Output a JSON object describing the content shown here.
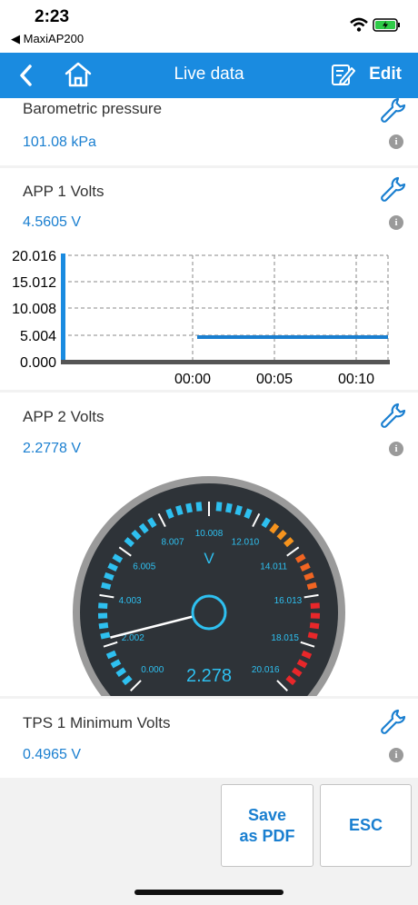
{
  "status": {
    "time": "2:23",
    "back_app": "◀ MaxiAP200"
  },
  "nav": {
    "title": "Live data",
    "edit_label": "Edit"
  },
  "items": [
    {
      "name": "Barometric pressure",
      "value": "101.08 kPa"
    },
    {
      "name": "APP 1 Volts",
      "value": "4.5605 V"
    },
    {
      "name": "APP 2 Volts",
      "value": "2.2778 V"
    },
    {
      "name": "TPS 1 Minimum Volts",
      "value": "0.4965 V"
    }
  ],
  "line_chart": {
    "y_ticks": [
      "20.016",
      "15.012",
      "10.008",
      "5.004",
      "0.000"
    ],
    "x_ticks": [
      "00:00",
      "00:05",
      "00:10"
    ]
  },
  "gauge": {
    "unit": "V",
    "reading": "2.278",
    "value": 2.278,
    "max": 20.016,
    "scale_labels": [
      "0.000",
      "2.002",
      "4.003",
      "6.005",
      "8.007",
      "10.008",
      "12.010",
      "14.011",
      "16.013",
      "18.015",
      "20.016"
    ]
  },
  "buttons": {
    "save_pdf_line1": "Save",
    "save_pdf_line2": "as PDF",
    "esc": "ESC"
  },
  "colors": {
    "accent": "#1a8be0",
    "value_text": "#1a7fd0"
  }
}
